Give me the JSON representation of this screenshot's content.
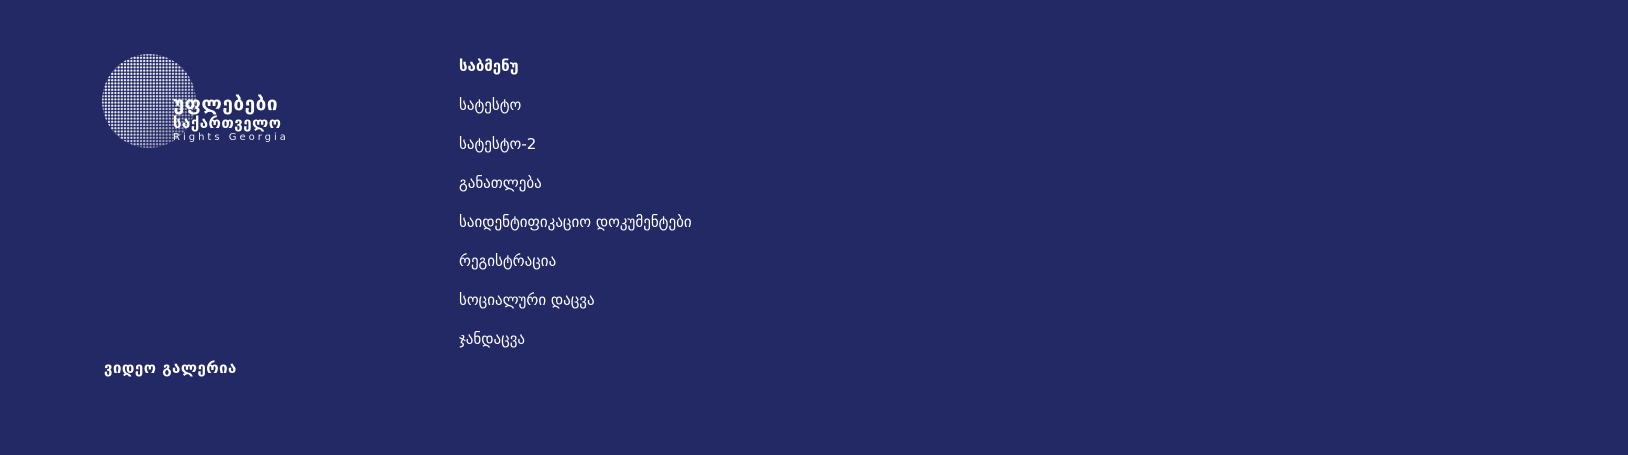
{
  "colors": {
    "background": "#222965",
    "text": "#ffffff"
  },
  "logo": {
    "line1": "უფლებები",
    "line2": "საქართველო",
    "line3": "Rights Georgia",
    "icon": "halftone-globe-icon"
  },
  "menu": {
    "title": "საბმენუ",
    "items": [
      {
        "label": "სატესტო"
      },
      {
        "label": "სატესტო-2"
      },
      {
        "label": "განათლება"
      },
      {
        "label": "საიდენტიფიკაციო დოკუმენტები"
      },
      {
        "label": "რეგისტრაცია"
      },
      {
        "label": "სოციალური დაცვა"
      },
      {
        "label": "ჯანდაცვა"
      }
    ]
  },
  "video_gallery": {
    "label": "ვიდეო გალერია"
  }
}
